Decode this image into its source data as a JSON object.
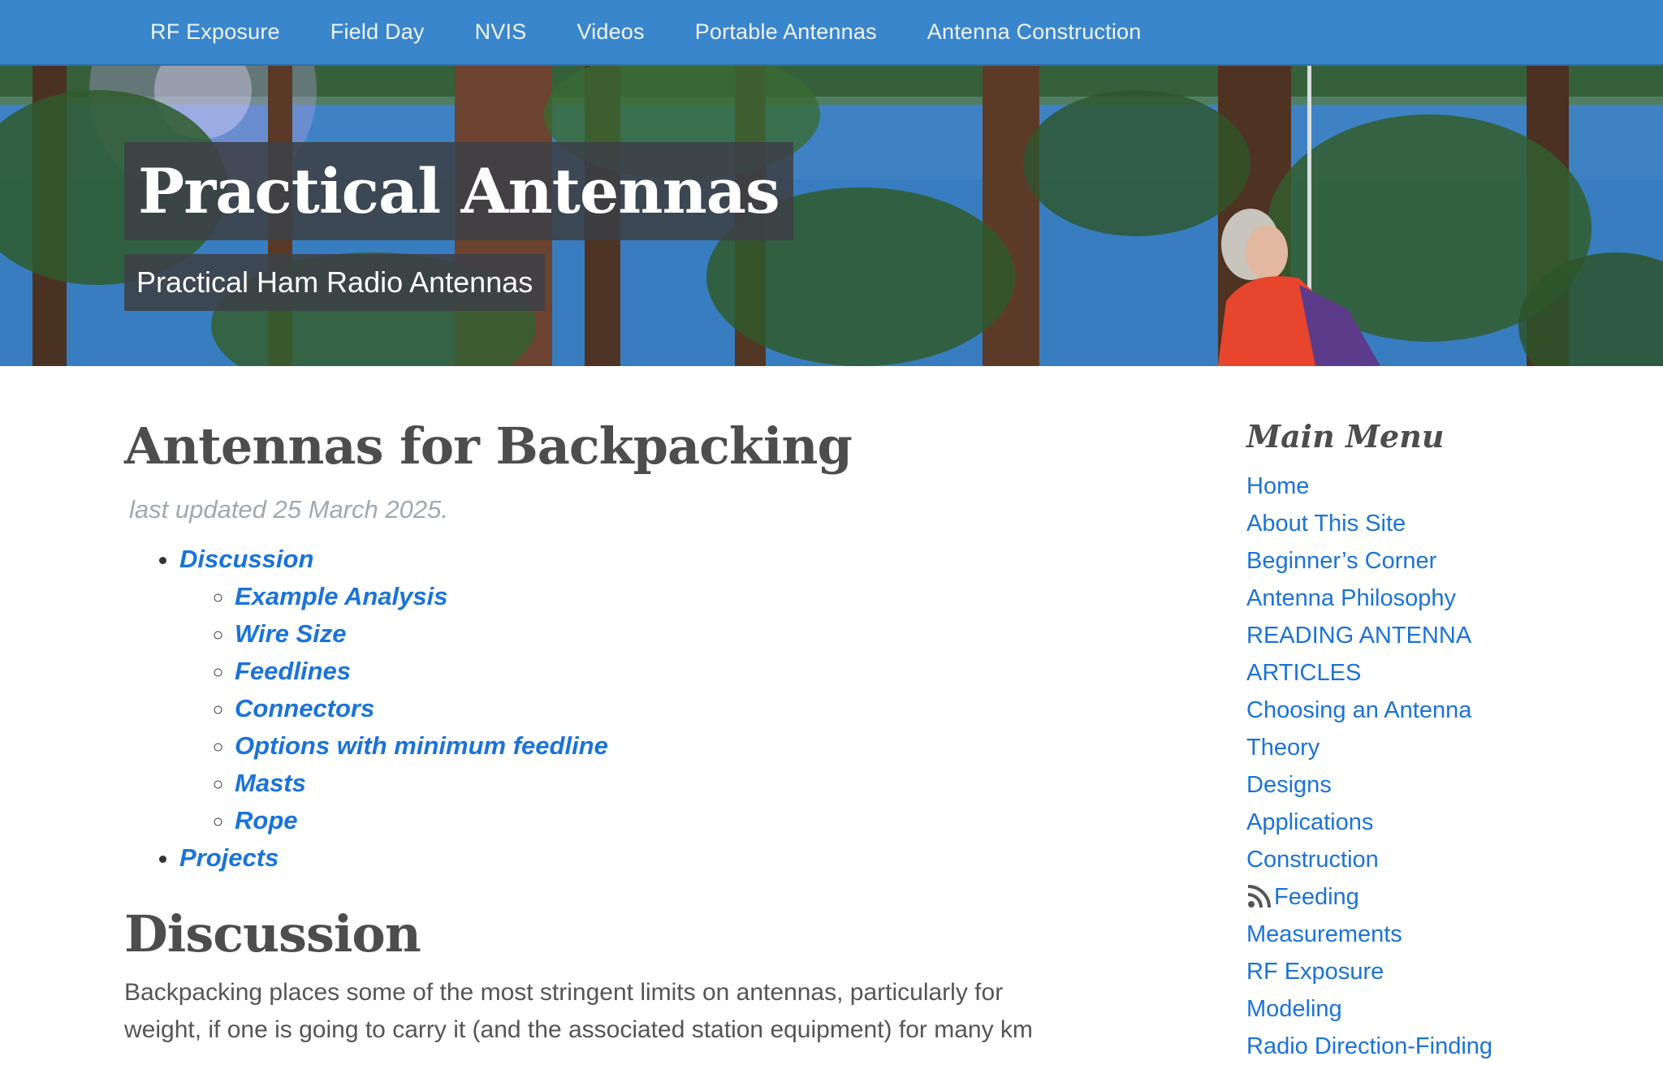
{
  "nav": {
    "items": [
      {
        "label": "RF Exposure"
      },
      {
        "label": "Field Day"
      },
      {
        "label": "NVIS"
      },
      {
        "label": "Videos"
      },
      {
        "label": "Portable Antennas"
      },
      {
        "label": "Antenna Construction"
      }
    ]
  },
  "banner": {
    "site_title": "Practical Antennas",
    "tagline": "Practical Ham Radio Antennas"
  },
  "article": {
    "title": "Antennas for Backpacking",
    "updated": "last updated 25 March 2025.",
    "toc": {
      "discussion": "Discussion",
      "sub": [
        "Example Analysis",
        "Wire Size",
        "Feedlines",
        "Connectors",
        "Options with minimum feedline",
        "Masts",
        "Rope"
      ],
      "projects": "Projects"
    },
    "section_title": "Discussion",
    "intro_line1": "Backpacking places some of the most stringent limits on antennas, particularly for",
    "intro_line2": "weight, if one is going to carry it (and the associated station equipment) for many km"
  },
  "sidebar": {
    "heading": "Main Menu",
    "items": [
      "Home",
      "About This Site",
      "Beginner’s Corner",
      "Antenna Philosophy",
      "READING ANTENNA",
      "ARTICLES",
      "Choosing an Antenna",
      "Theory",
      "Designs",
      "Applications",
      "Construction",
      "Feeding",
      "Measurements",
      "RF Exposure",
      "Modeling",
      "Radio Direction-Finding"
    ],
    "feeding_icon": "rss-icon"
  },
  "colors": {
    "nav_bg": "#3a86cc",
    "link": "#1a73d9",
    "heading": "#4d4d4d",
    "muted": "#a0a8b0"
  }
}
